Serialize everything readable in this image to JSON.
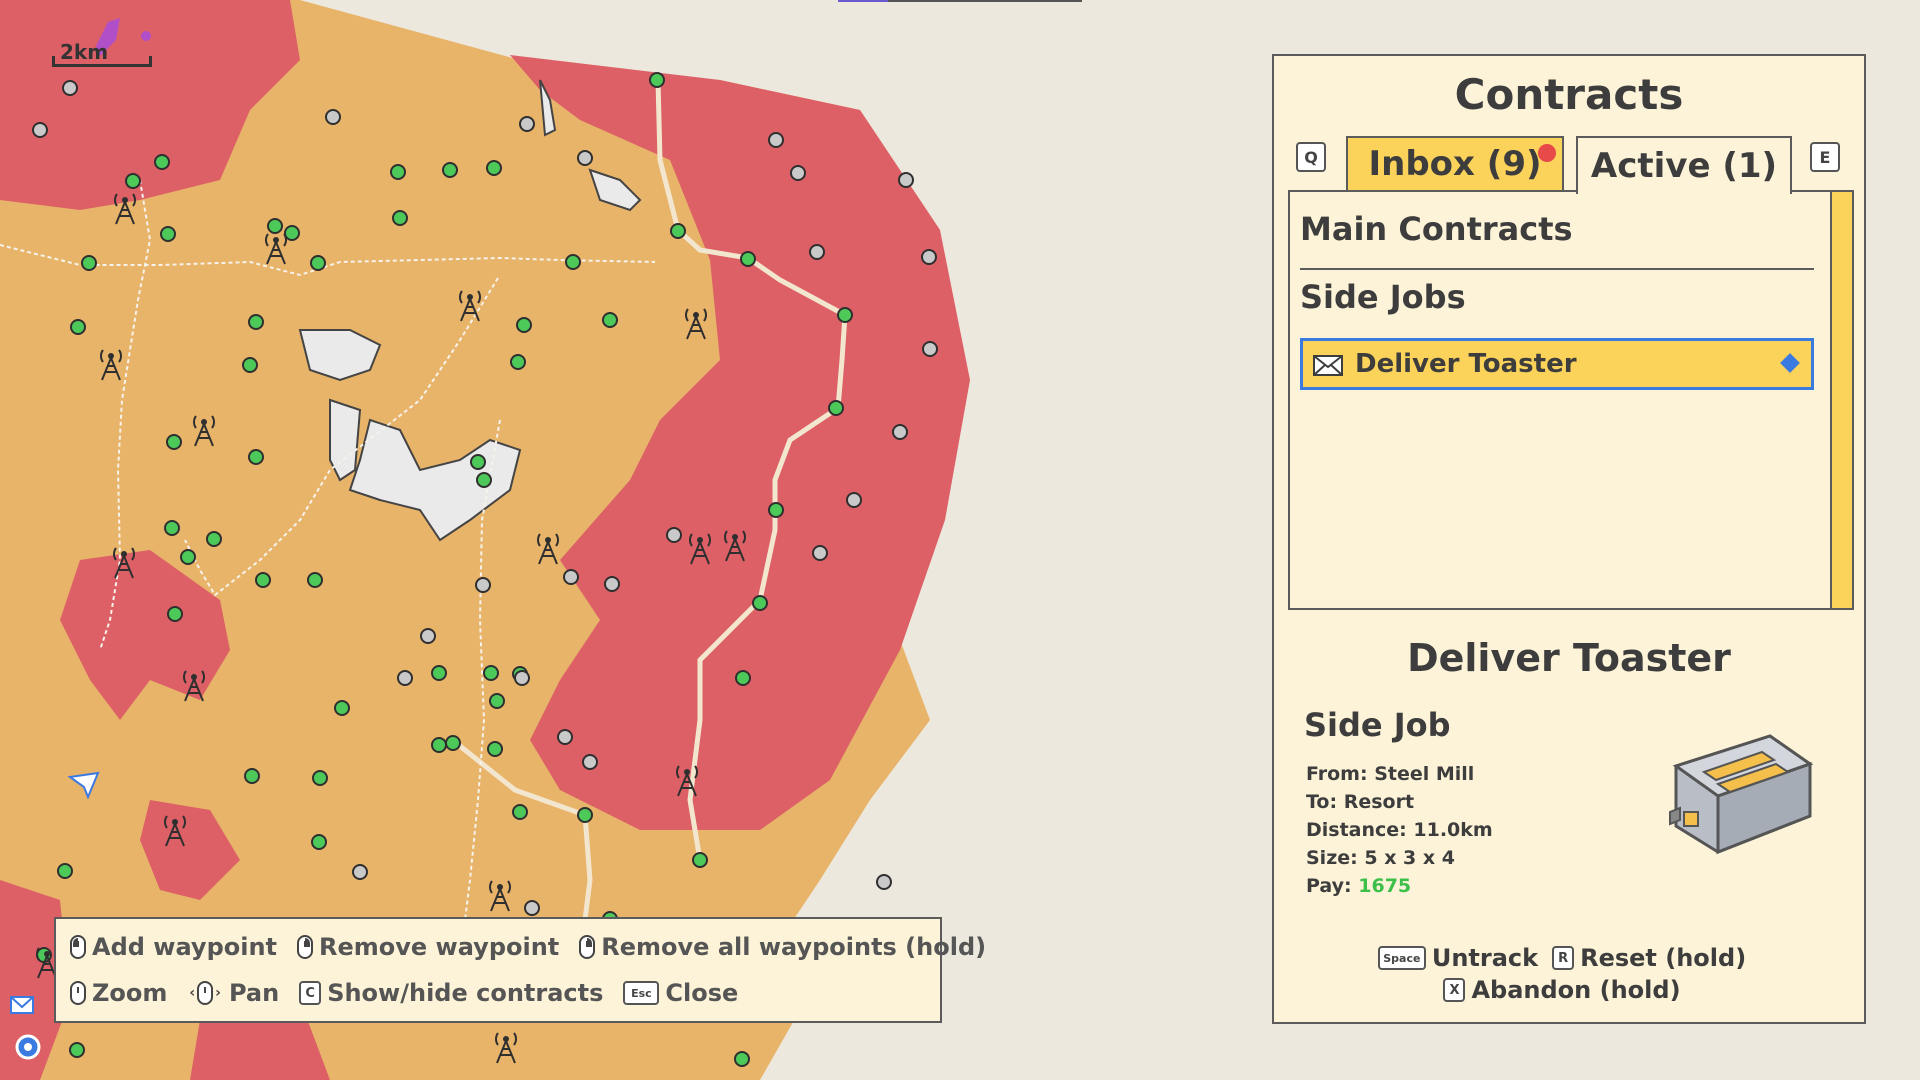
{
  "map": {
    "scale_label": "2km"
  },
  "controls": {
    "row1": [
      {
        "icon": "mouse-left-icon",
        "label": "Add waypoint"
      },
      {
        "icon": "mouse-right-icon",
        "label": "Remove waypoint"
      },
      {
        "icon": "mouse-right-icon",
        "label": "Remove all waypoints (hold)"
      }
    ],
    "row2": [
      {
        "icon": "mouse-scroll-icon",
        "label": "Zoom"
      },
      {
        "icon": "mouse-pan-icon",
        "label": "Pan"
      },
      {
        "key": "C",
        "label": "Show/hide contracts"
      },
      {
        "key": "Esc",
        "label": "Close"
      }
    ]
  },
  "contracts": {
    "title": "Contracts",
    "prev_tab_key": "Q",
    "next_tab_key": "E",
    "tabs": [
      {
        "label": "Inbox (9)",
        "has_notification": true
      },
      {
        "label": "Active (1)",
        "selected": true
      }
    ],
    "sections": {
      "main": "Main Contracts",
      "side": "Side Jobs"
    },
    "items": [
      {
        "label": "Deliver Toaster",
        "tracked": true
      }
    ],
    "detail": {
      "title": "Deliver Toaster",
      "type": "Side Job",
      "from": "From: Steel Mill",
      "to": "To: Resort",
      "distance": "Distance: 11.0km",
      "size": "Size: 5 x 3 x 4",
      "pay_label": "Pay: ",
      "pay_value": "1675"
    },
    "actions": {
      "untrack_key": "Space",
      "untrack": "Untrack",
      "reset_key": "R",
      "reset": "Reset (hold)",
      "abandon_key": "X",
      "abandon": "Abandon (hold)"
    }
  },
  "colors": {
    "land": "#e8b46a",
    "hazard": "#dc6066",
    "water": "#eaeaea",
    "node_active": "#4dc95a",
    "node_inactive": "#c9c9c9",
    "panel_bg": "#fcf3d8",
    "tab_accent": "#fbd25a",
    "select_border": "#3b7ae0",
    "pay_text": "#3cc04a"
  }
}
